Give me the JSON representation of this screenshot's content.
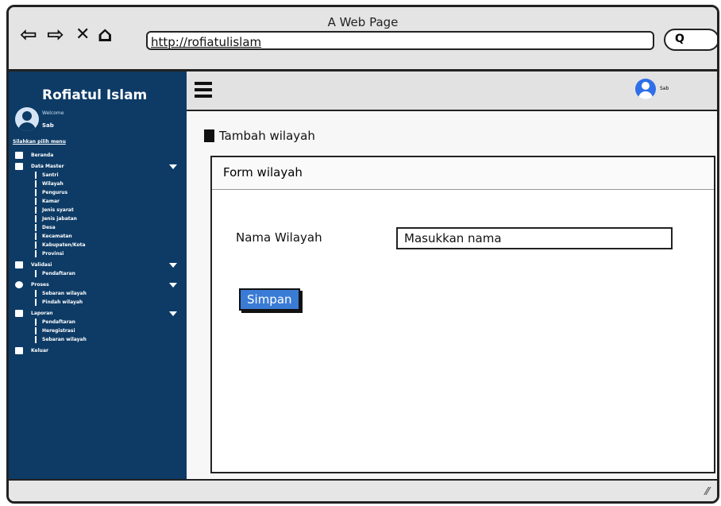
{
  "browser": {
    "window_title": "A Web Page",
    "url": "http://rofiatulislam",
    "nav_back": "⇦",
    "nav_forward": "⇨",
    "nav_close": "✕",
    "nav_home": "⌂",
    "search_glyph": "Q"
  },
  "sidebar": {
    "brand": "Rofiatul Islam",
    "welcome": "Welcome",
    "user": "Sab",
    "hint": "Silahkan pilih menu",
    "items": [
      {
        "label": "Beranda",
        "level": "top",
        "icon": "edit-icon"
      },
      {
        "label": "Data Master",
        "level": "top",
        "icon": "folder-icon",
        "caret": true
      },
      {
        "label": "Santri",
        "level": "sub"
      },
      {
        "label": "Wilayah",
        "level": "sub"
      },
      {
        "label": "Pengurus",
        "level": "sub"
      },
      {
        "label": "Kamar",
        "level": "sub"
      },
      {
        "label": "Jenis syarat",
        "level": "sub"
      },
      {
        "label": "Jenis jabatan",
        "level": "sub"
      },
      {
        "label": "Desa",
        "level": "sub"
      },
      {
        "label": "Kecamatan",
        "level": "sub"
      },
      {
        "label": "Kabupaten/Kota",
        "level": "sub"
      },
      {
        "label": "Provinsi",
        "level": "sub"
      },
      {
        "label": "Validasi",
        "level": "top",
        "icon": "pencil-icon",
        "caret": true
      },
      {
        "label": "Pendaftaran",
        "level": "sub"
      },
      {
        "label": "Proses",
        "level": "top",
        "icon": "gear-icon",
        "caret": true
      },
      {
        "label": "Sebaran wilayah",
        "level": "sub"
      },
      {
        "label": "Pindah wilayah",
        "level": "sub"
      },
      {
        "label": "Laporan",
        "level": "top",
        "icon": "document-icon",
        "caret": true
      },
      {
        "label": "Pendaftaran",
        "level": "sub"
      },
      {
        "label": "Heregistrasi",
        "level": "sub"
      },
      {
        "label": "Sebaran wilayah",
        "level": "sub"
      },
      {
        "label": "Keluar",
        "level": "top",
        "icon": "logout-icon"
      }
    ]
  },
  "topbar": {
    "user": "Sab",
    "accent_color": "#2f6fe8"
  },
  "main": {
    "title": "Tambah wilayah",
    "panel_title": "Form wilayah",
    "field_label": "Nama Wilayah",
    "field_placeholder": "Masukkan nama",
    "save_label": "Simpan"
  },
  "colors": {
    "sidebar_bg": "#0d3b66",
    "button_bg": "#3a7bd5"
  }
}
